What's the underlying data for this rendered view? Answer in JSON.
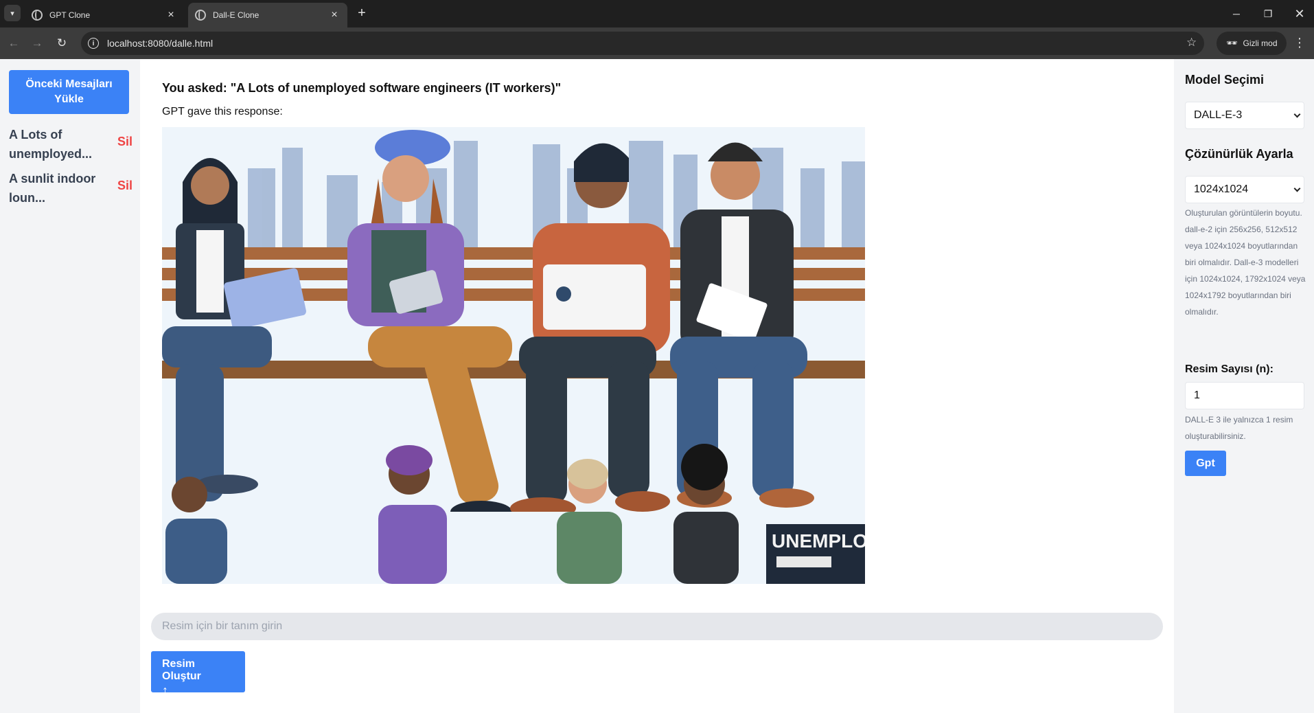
{
  "browser": {
    "tabs": [
      {
        "title": "GPT Clone",
        "active": false
      },
      {
        "title": "Dall-E Clone",
        "active": true
      }
    ],
    "url": "localhost:8080/dalle.html",
    "incognito_label": "Gizli mod",
    "icons": {
      "tab_search": "chevron-down-icon",
      "new_tab": "plus-icon",
      "back": "arrow-left-icon",
      "forward": "arrow-right-icon",
      "reload": "reload-icon",
      "site_info": "info-icon",
      "bookmark": "star-icon",
      "menu": "kebab-menu-icon"
    }
  },
  "sidebar": {
    "load_button": "Önceki Mesajları Yükle",
    "history": [
      {
        "label": "A Lots of unemployed...",
        "delete": "Sil"
      },
      {
        "label": "A sunlit indoor loun...",
        "delete": "Sil"
      }
    ]
  },
  "chat": {
    "question": "You asked: \"A Lots of unemployed software engineers (IT workers)\"",
    "response_label": "GPT gave this response:",
    "image": {
      "alt": "Illustration of unemployed software engineers on a bench",
      "sign_text": "UNEMPLOY"
    }
  },
  "composer": {
    "placeholder": "Resim için bir tanım girin",
    "create_button": "Resim Oluştur",
    "create_icon": "↑"
  },
  "settings": {
    "model_heading": "Model Seçimi",
    "model_selected": "DALL-E-3",
    "resolution_heading": "Çözünürlük Ayarla",
    "resolution_selected": "1024x1024",
    "resolution_help": "Oluşturulan görüntülerin boyutu. dall-e-2 için 256x256, 512x512 veya 1024x1024 boyutlarından biri olmalıdır. Dall-e-3 modelleri için 1024x1024, 1792x1024 veya 1024x1792 boyutlarından biri olmalıdır.",
    "count_heading": "Resim Sayısı (n):",
    "count_value": "1",
    "count_help": "DALL-E 3 ile yalnızca 1 resim oluşturabilirsiniz.",
    "gpt_button": "Gpt"
  },
  "colors": {
    "accent": "#3b82f6",
    "danger": "#ef4444",
    "sidebar_bg": "#f3f4f6",
    "chrome_dark": "#1f1f1f"
  }
}
